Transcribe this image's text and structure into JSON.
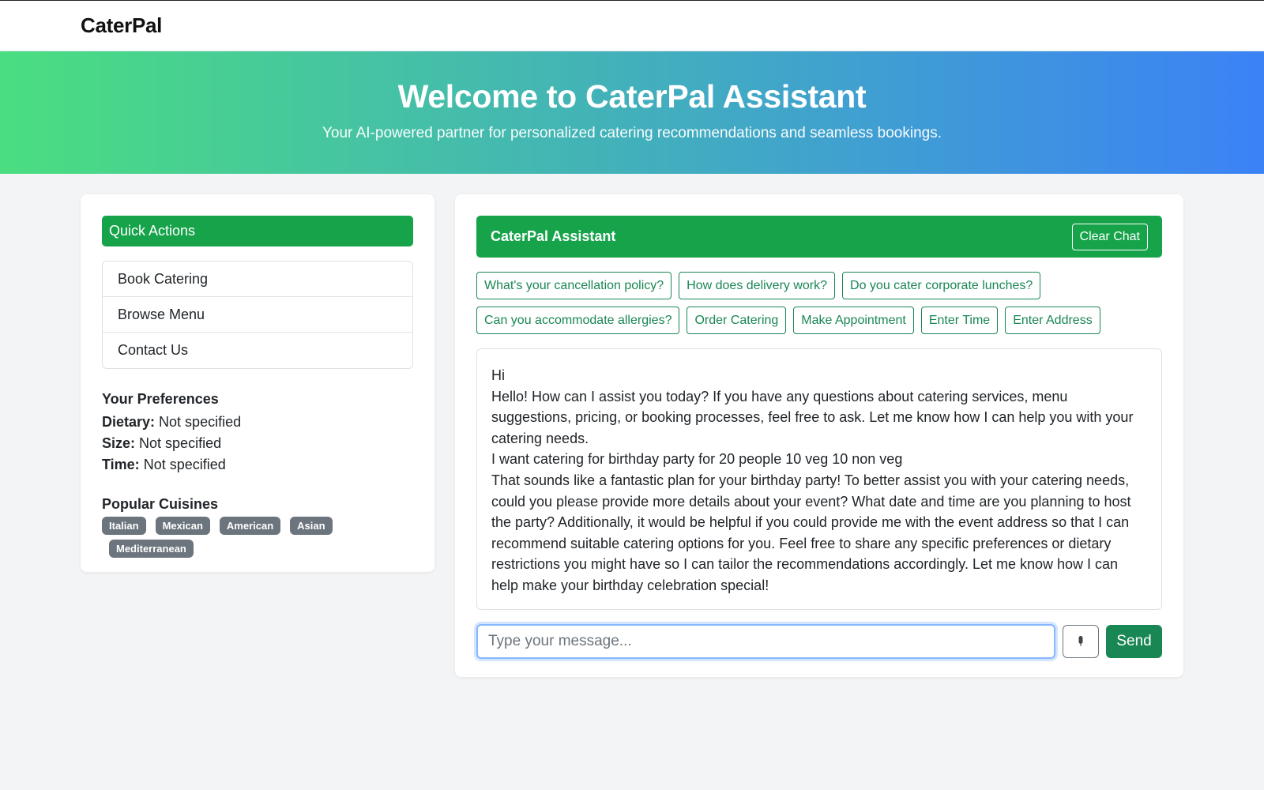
{
  "nav": {
    "brand": "CaterPal"
  },
  "hero": {
    "title": "Welcome to CaterPal Assistant",
    "subtitle": "Your AI-powered partner for personalized catering recommendations and seamless bookings."
  },
  "sidebar": {
    "quick_actions_title": "Quick Actions",
    "actions": [
      {
        "label": "Book Catering"
      },
      {
        "label": "Browse Menu"
      },
      {
        "label": "Contact Us"
      }
    ],
    "preferences": {
      "title": "Your Preferences",
      "dietary_label": "Dietary:",
      "dietary_value": "Not specified",
      "size_label": "Size:",
      "size_value": "Not specified",
      "time_label": "Time:",
      "time_value": "Not specified"
    },
    "cuisines": {
      "title": "Popular Cuisines",
      "items": [
        "Italian",
        "Mexican",
        "American",
        "Asian",
        "Mediterranean"
      ]
    }
  },
  "chat": {
    "title": "CaterPal Assistant",
    "clear_label": "Clear Chat",
    "suggestions": [
      "What's your cancellation policy?",
      "How does delivery work?",
      "Do you cater corporate lunches?",
      "Can you accommodate allergies?",
      "Order Catering",
      "Make Appointment",
      "Enter Time",
      "Enter Address"
    ],
    "messages": [
      {
        "role": "user",
        "text": "Hi"
      },
      {
        "role": "assistant",
        "text": "Hello! How can I assist you today? If you have any questions about catering services, menu suggestions, pricing, or booking processes, feel free to ask. Let me know how I can help you with your catering needs."
      },
      {
        "role": "user",
        "text": "I want catering for birthday party for 20 people 10 veg 10 non veg"
      },
      {
        "role": "assistant",
        "text": "That sounds like a fantastic plan for your birthday party! To better assist you with your catering needs, could you please provide more details about your event? What date and time are you planning to host the party? Additionally, it would be helpful if you could provide me with the event address so that I can recommend suitable catering options for you. Feel free to share any specific preferences or dietary restrictions you might have so I can tailor the recommendations accordingly. Let me know how I can help make your birthday celebration special!"
      }
    ],
    "input": {
      "value": "",
      "placeholder": "Type your message..."
    },
    "send_label": "Send"
  }
}
